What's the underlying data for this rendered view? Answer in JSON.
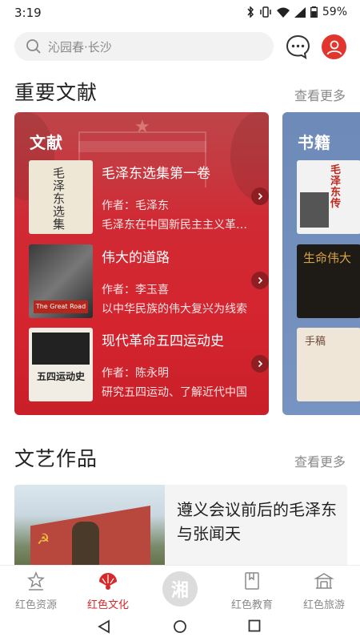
{
  "status_bar": {
    "time": "3:19",
    "battery": "59%"
  },
  "search": {
    "placeholder": "沁园春·长沙"
  },
  "sections": {
    "literature": {
      "title": "重要文献",
      "more": "查看更多",
      "card_label": "文献",
      "books": [
        {
          "title": "毛泽东选集第一卷",
          "author": "作者：毛泽东",
          "desc": "毛泽东在中国新民主主义革命时期的重要著作",
          "cover_text": "毛泽东选集"
        },
        {
          "title": "伟大的道路",
          "author": "作者：李玉喜",
          "desc": "以中华民族的伟大复兴为线索",
          "cover_text": "The Great Road"
        },
        {
          "title": "现代革命五四运动史",
          "author": "作者：陈永明",
          "desc": "研究五四运动、了解近代中国",
          "cover_text": "五四运动史"
        }
      ]
    },
    "books": {
      "card_label": "书籍",
      "covers": [
        "毛泽东传",
        "生命伟大",
        "手稿"
      ]
    },
    "art": {
      "title": "文艺作品",
      "more": "查看更多",
      "item_title": "遵义会议前后的毛泽东与张闻天"
    }
  },
  "bottom_nav": [
    {
      "label": "红色资源",
      "icon": "star-pavilion-icon",
      "active": false
    },
    {
      "label": "红色文化",
      "icon": "fan-icon",
      "active": true
    },
    {
      "label": "湘",
      "icon": "center-logo",
      "active": false
    },
    {
      "label": "红色教育",
      "icon": "book-icon",
      "active": false
    },
    {
      "label": "红色旅游",
      "icon": "building-icon",
      "active": false
    }
  ],
  "colors": {
    "accent": "#d62a2a",
    "literature_card": "#d4252f",
    "books_card": "#7693c2",
    "muted_text": "#8a8a8a"
  }
}
